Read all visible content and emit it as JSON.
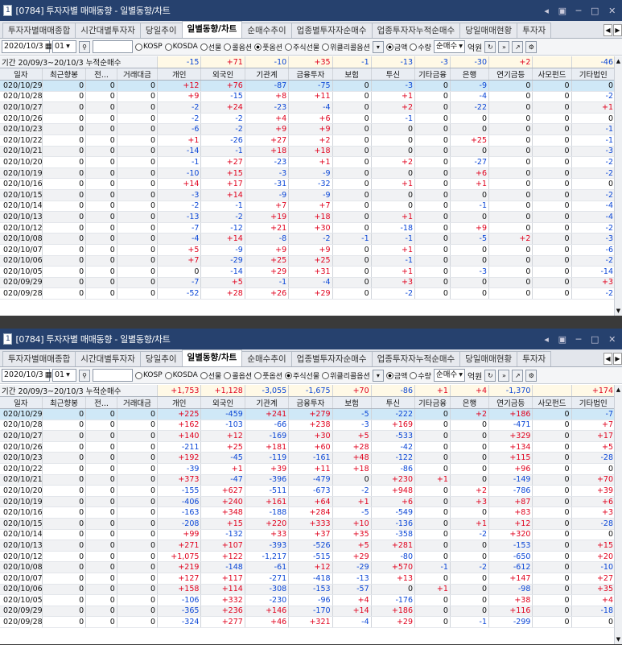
{
  "window_title": "[0784] 투자자별 매매동향 - 일별동향/차트",
  "window_num": "1",
  "tabs": [
    "투자자별매매종합",
    "시간대별투자자",
    "당일추이",
    "일별동향/차트",
    "순매수추이",
    "업종별투자자순매수",
    "업종투자자누적순매수",
    "당일매매현황",
    "투자자"
  ],
  "active_tab": 3,
  "columns": [
    "일자",
    "최근향봉",
    "전...",
    "거래대금",
    "개인",
    "외국인",
    "기관계",
    "금융투자",
    "보험",
    "투신",
    "기타금융",
    "은행",
    "연기금등",
    "사모펀드",
    "기타법인"
  ],
  "windows": [
    {
      "date_from": "2020/10/3",
      "code": "01",
      "start": "20/09/3",
      "end": "20/10/3",
      "sum_label": "누적순매수",
      "radios": [
        "KOSP",
        "KOSDA",
        "선물",
        "콜옵션",
        "풋옵션",
        "주식선물",
        "위클리콜옵션"
      ],
      "radio_on": 4,
      "unit_opts": [
        "금액",
        "수량"
      ],
      "unit_on": 0,
      "mode": "순매수",
      "unit": "억원",
      "sums": [
        "-15",
        "+71",
        "-10",
        "+35",
        "-1",
        "-13",
        "-3",
        "-30",
        "+2",
        "",
        "-46"
      ],
      "rows": [
        [
          "020/10/29",
          "0",
          "0",
          "0",
          "+12",
          "+76",
          "-87",
          "-75",
          "0",
          "-3",
          "0",
          "-9",
          "0",
          "0",
          "0"
        ],
        [
          "020/10/28",
          "0",
          "0",
          "0",
          "+9",
          "-15",
          "+8",
          "+11",
          "0",
          "+1",
          "0",
          "-4",
          "0",
          "0",
          "-2"
        ],
        [
          "020/10/27",
          "0",
          "0",
          "0",
          "-2",
          "+24",
          "-23",
          "-4",
          "0",
          "+2",
          "0",
          "-22",
          "0",
          "0",
          "+1"
        ],
        [
          "020/10/26",
          "0",
          "0",
          "0",
          "-2",
          "-2",
          "+4",
          "+6",
          "0",
          "-1",
          "0",
          "0",
          "0",
          "0",
          "0"
        ],
        [
          "020/10/23",
          "0",
          "0",
          "0",
          "-6",
          "-2",
          "+9",
          "+9",
          "0",
          "0",
          "0",
          "0",
          "0",
          "0",
          "-1"
        ],
        [
          "020/10/22",
          "0",
          "0",
          "0",
          "+1",
          "-26",
          "+27",
          "+2",
          "0",
          "0",
          "0",
          "+25",
          "0",
          "0",
          "-1"
        ],
        [
          "020/10/21",
          "0",
          "0",
          "0",
          "-14",
          "-1",
          "+18",
          "+18",
          "0",
          "0",
          "0",
          "0",
          "0",
          "0",
          "-3"
        ],
        [
          "020/10/20",
          "0",
          "0",
          "0",
          "-1",
          "+27",
          "-23",
          "+1",
          "0",
          "+2",
          "0",
          "-27",
          "0",
          "0",
          "-2"
        ],
        [
          "020/10/19",
          "0",
          "0",
          "0",
          "-10",
          "+15",
          "-3",
          "-9",
          "0",
          "0",
          "0",
          "+6",
          "0",
          "0",
          "-2"
        ],
        [
          "020/10/16",
          "0",
          "0",
          "0",
          "+14",
          "+17",
          "-31",
          "-32",
          "0",
          "+1",
          "0",
          "+1",
          "0",
          "0",
          "0"
        ],
        [
          "020/10/15",
          "0",
          "0",
          "0",
          "-3",
          "+14",
          "-9",
          "-9",
          "0",
          "0",
          "0",
          "0",
          "0",
          "0",
          "-2"
        ],
        [
          "020/10/14",
          "0",
          "0",
          "0",
          "-2",
          "-1",
          "+7",
          "+7",
          "0",
          "0",
          "0",
          "-1",
          "0",
          "0",
          "-4"
        ],
        [
          "020/10/13",
          "0",
          "0",
          "0",
          "-13",
          "-2",
          "+19",
          "+18",
          "0",
          "+1",
          "0",
          "0",
          "0",
          "0",
          "-4"
        ],
        [
          "020/10/12",
          "0",
          "0",
          "0",
          "-7",
          "-12",
          "+21",
          "+30",
          "0",
          "-18",
          "0",
          "+9",
          "0",
          "0",
          "-2"
        ],
        [
          "020/10/08",
          "0",
          "0",
          "0",
          "-4",
          "+14",
          "-8",
          "-2",
          "-1",
          "-1",
          "0",
          "-5",
          "+2",
          "0",
          "-3"
        ],
        [
          "020/10/07",
          "0",
          "0",
          "0",
          "+5",
          "-9",
          "+9",
          "+9",
          "0",
          "+1",
          "0",
          "0",
          "0",
          "0",
          "-6"
        ],
        [
          "020/10/06",
          "0",
          "0",
          "0",
          "+7",
          "-29",
          "+25",
          "+25",
          "0",
          "-1",
          "0",
          "0",
          "0",
          "0",
          "-2"
        ],
        [
          "020/10/05",
          "0",
          "0",
          "0",
          "0",
          "-14",
          "+29",
          "+31",
          "0",
          "+1",
          "0",
          "-3",
          "0",
          "0",
          "-14"
        ],
        [
          "020/09/29",
          "0",
          "0",
          "0",
          "-7",
          "+5",
          "-1",
          "-4",
          "0",
          "+3",
          "0",
          "0",
          "0",
          "0",
          "+3"
        ],
        [
          "020/09/28",
          "0",
          "0",
          "0",
          "-52",
          "+28",
          "+26",
          "+29",
          "0",
          "-2",
          "0",
          "0",
          "0",
          "0",
          "-2"
        ]
      ]
    },
    {
      "date_from": "2020/10/3",
      "code": "01",
      "start": "20/09/3",
      "end": "20/10/3",
      "sum_label": "누적순매수",
      "radios": [
        "KOSP",
        "KOSDA",
        "선물",
        "콜옵션",
        "풋옵션",
        "주식선물",
        "위클리콜옵션"
      ],
      "radio_on": 5,
      "unit_opts": [
        "금액",
        "수량"
      ],
      "unit_on": 0,
      "mode": "순매수",
      "unit": "억원",
      "sums": [
        "+1,753",
        "+1,128",
        "-3,055",
        "-1,675",
        "+70",
        "-86",
        "+1",
        "+4",
        "-1,370",
        "",
        "+174"
      ],
      "rows": [
        [
          "020/10/29",
          "0",
          "0",
          "0",
          "+225",
          "-459",
          "+241",
          "+279",
          "-5",
          "-222",
          "0",
          "+2",
          "+186",
          "0",
          "-7"
        ],
        [
          "020/10/28",
          "0",
          "0",
          "0",
          "+162",
          "-103",
          "-66",
          "+238",
          "-3",
          "+169",
          "0",
          "0",
          "-471",
          "0",
          "+7"
        ],
        [
          "020/10/27",
          "0",
          "0",
          "0",
          "+140",
          "+12",
          "-169",
          "+30",
          "+5",
          "-533",
          "0",
          "0",
          "+329",
          "0",
          "+17"
        ],
        [
          "020/10/26",
          "0",
          "0",
          "0",
          "-211",
          "+25",
          "+181",
          "+60",
          "+28",
          "-42",
          "0",
          "0",
          "+134",
          "0",
          "+5"
        ],
        [
          "020/10/23",
          "0",
          "0",
          "0",
          "+192",
          "-45",
          "-119",
          "-161",
          "+48",
          "-122",
          "0",
          "0",
          "+115",
          "0",
          "-28"
        ],
        [
          "020/10/22",
          "0",
          "0",
          "0",
          "-39",
          "+1",
          "+39",
          "+11",
          "+18",
          "-86",
          "0",
          "0",
          "+96",
          "0",
          "0"
        ],
        [
          "020/10/21",
          "0",
          "0",
          "0",
          "+373",
          "-47",
          "-396",
          "-479",
          "0",
          "+230",
          "+1",
          "0",
          "-149",
          "0",
          "+70"
        ],
        [
          "020/10/20",
          "0",
          "0",
          "0",
          "-155",
          "+627",
          "-511",
          "-673",
          "-2",
          "+948",
          "0",
          "+2",
          "-786",
          "0",
          "+39"
        ],
        [
          "020/10/19",
          "0",
          "0",
          "0",
          "-406",
          "+240",
          "+161",
          "+64",
          "+1",
          "+6",
          "0",
          "+3",
          "+87",
          "0",
          "+6"
        ],
        [
          "020/10/16",
          "0",
          "0",
          "0",
          "-163",
          "+348",
          "-188",
          "+284",
          "-5",
          "-549",
          "0",
          "0",
          "+83",
          "0",
          "+3"
        ],
        [
          "020/10/15",
          "0",
          "0",
          "0",
          "-208",
          "+15",
          "+220",
          "+333",
          "+10",
          "-136",
          "0",
          "+1",
          "+12",
          "0",
          "-28"
        ],
        [
          "020/10/14",
          "0",
          "0",
          "0",
          "+99",
          "-132",
          "+33",
          "+37",
          "+35",
          "-358",
          "0",
          "-2",
          "+320",
          "0",
          "0"
        ],
        [
          "020/10/13",
          "0",
          "0",
          "0",
          "+271",
          "+107",
          "-393",
          "-526",
          "+5",
          "+281",
          "0",
          "0",
          "-153",
          "0",
          "+15"
        ],
        [
          "020/10/12",
          "0",
          "0",
          "0",
          "+1,075",
          "+122",
          "-1,217",
          "-515",
          "+29",
          "-80",
          "0",
          "0",
          "-650",
          "0",
          "+20"
        ],
        [
          "020/10/08",
          "0",
          "0",
          "0",
          "+219",
          "-148",
          "-61",
          "+12",
          "-29",
          "+570",
          "-1",
          "-2",
          "-612",
          "0",
          "-10"
        ],
        [
          "020/10/07",
          "0",
          "0",
          "0",
          "+127",
          "+117",
          "-271",
          "-418",
          "-13",
          "+13",
          "0",
          "0",
          "+147",
          "0",
          "+27"
        ],
        [
          "020/10/06",
          "0",
          "0",
          "0",
          "+158",
          "+114",
          "-308",
          "-153",
          "-57",
          "0",
          "+1",
          "0",
          "-98",
          "0",
          "+35"
        ],
        [
          "020/10/05",
          "0",
          "0",
          "0",
          "-106",
          "+332",
          "-230",
          "-96",
          "+4",
          "-176",
          "0",
          "0",
          "+38",
          "0",
          "+4"
        ],
        [
          "020/09/29",
          "0",
          "0",
          "0",
          "-365",
          "+236",
          "+146",
          "-170",
          "+14",
          "+186",
          "0",
          "0",
          "+116",
          "0",
          "-18"
        ],
        [
          "020/09/28",
          "0",
          "0",
          "0",
          "-324",
          "+277",
          "+46",
          "+321",
          "-4",
          "+29",
          "0",
          "-1",
          "-299",
          "0",
          "0"
        ]
      ]
    }
  ]
}
